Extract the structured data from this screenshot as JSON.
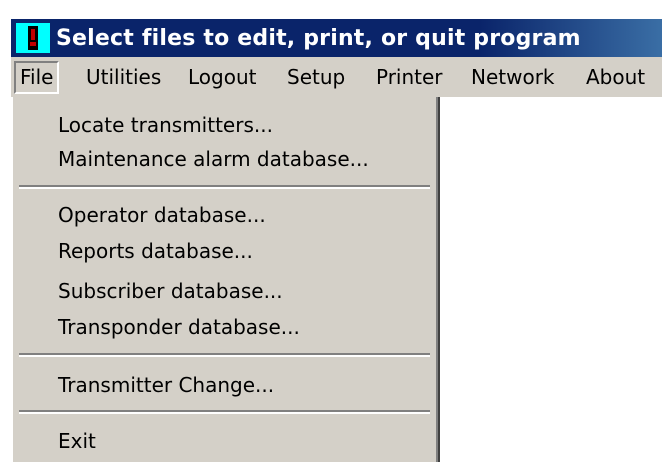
{
  "window": {
    "title": "Select files to edit, print, or quit program",
    "icon": "transmitter-app-icon"
  },
  "menubar": {
    "items": [
      {
        "label": "File",
        "active": true
      },
      {
        "label": "Utilities"
      },
      {
        "label": "Logout"
      },
      {
        "label": "Setup"
      },
      {
        "label": "Printer"
      },
      {
        "label": "Network"
      },
      {
        "label": "About"
      }
    ]
  },
  "file_menu": {
    "groups": [
      [
        "Locate transmitters...",
        "Maintenance alarm database..."
      ],
      [
        "Operator database...",
        "Reports database...",
        "Subscriber database...",
        "Transponder database..."
      ],
      [
        "Transmitter Change..."
      ],
      [
        "Exit"
      ]
    ]
  },
  "colors": {
    "titlebar": "#0a246a",
    "menu_face": "#d4d0c8",
    "icon_bg": "#00ffff"
  }
}
